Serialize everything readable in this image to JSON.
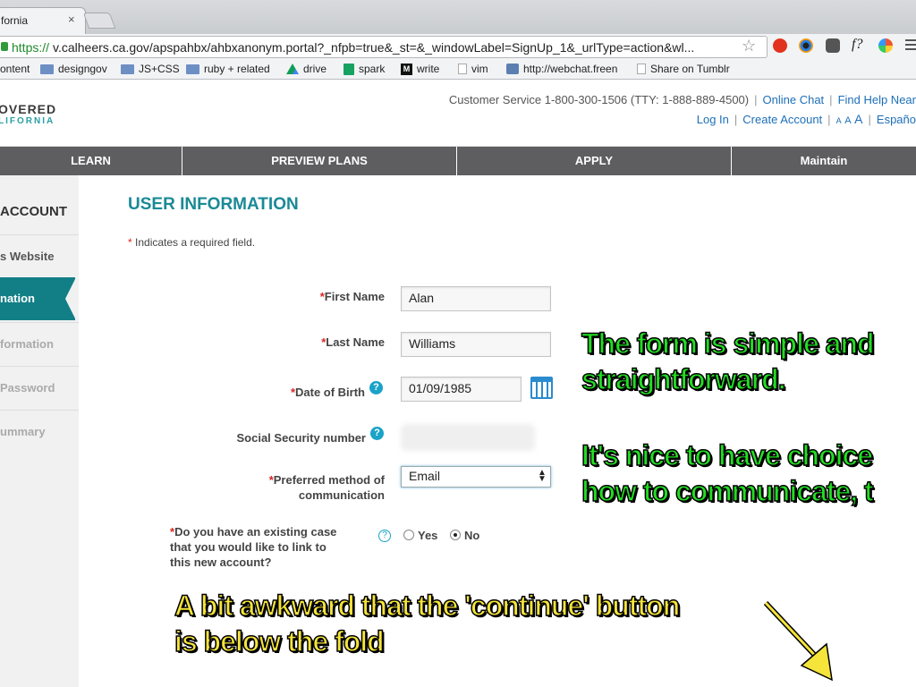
{
  "browser": {
    "tab_title": "fornia",
    "tab_close": "×",
    "url_protocol": "https://",
    "url_rest": "v.calheers.ca.gov/apspahbx/ahbxanonym.portal?_nfpb=true&_st=&_windowLabel=SignUp_1&_urlType=action&wl...",
    "star_icon": "☆",
    "ext_f": "f?",
    "bookmarks": [
      {
        "label": "ontent",
        "icon": "none"
      },
      {
        "label": "designgov",
        "icon": "folder-icon"
      },
      {
        "label": "JS+CSS",
        "icon": "folder-icon"
      },
      {
        "label": "ruby + related",
        "icon": "folder-icon"
      },
      {
        "label": "drive",
        "icon": "drive-icon"
      },
      {
        "label": "spark",
        "icon": "sheet-icon"
      },
      {
        "label": "write",
        "icon": "medium-icon"
      },
      {
        "label": "vim",
        "icon": "page-icon"
      },
      {
        "label": "http://webchat.freen",
        "icon": "chat-icon"
      },
      {
        "label": "Share on Tumblr",
        "icon": "page-icon"
      }
    ]
  },
  "header": {
    "logo_line1": "OVERED",
    "logo_line2": "LIFORNIA",
    "customer_service": "Customer Service 1-800-300-1506 (TTY: 1-888-889-4500)",
    "online_chat": "Online Chat",
    "find_help": "Find Help Near",
    "log_in": "Log In",
    "create_account": "Create Account",
    "font_small": "A",
    "font_medium": "A",
    "font_large": "A",
    "espanol": "Españo"
  },
  "nav": {
    "learn": "LEARN",
    "preview_plans": "PREVIEW PLANS",
    "apply": "APPLY",
    "maintain": "Maintain"
  },
  "sidebar": {
    "title": "ACCOUNT",
    "items": [
      "s Website",
      "nation",
      "formation",
      "Password",
      "ummary"
    ]
  },
  "form": {
    "title": "USER INFORMATION",
    "required_star": "*",
    "required_note": " Indicates a required field.",
    "first_name_label": "First Name",
    "first_name_value": "Alan",
    "last_name_label": "Last Name",
    "last_name_value": "Williams",
    "dob_label": "Date of Birth",
    "dob_value": "01/09/1985",
    "ssn_label": "Social Security number",
    "pref_label_1": "Preferred method of",
    "pref_label_2": "communication",
    "pref_value": "Email",
    "case_question": "Do you have an existing case that you would like to link to this new account?",
    "help_glyph": "?",
    "yes_label": "Yes",
    "no_label": "No",
    "selected": "No"
  },
  "annotations": {
    "green_1_line1": "The form is simple and",
    "green_1_line2": "straightforward.",
    "green_2_line1": "It's nice to have choice",
    "green_2_line2": "how to communicate, t",
    "yellow_line1": "A bit awkward that the 'continue' button",
    "yellow_line2": "is below the fold"
  },
  "colors": {
    "accent_teal": "#127f86",
    "title_teal": "#1a8a96",
    "nav_gray": "#5e5e60",
    "link_blue": "#1d6fb8",
    "annotation_green": "#22dd22",
    "annotation_yellow": "#f5e43a"
  }
}
